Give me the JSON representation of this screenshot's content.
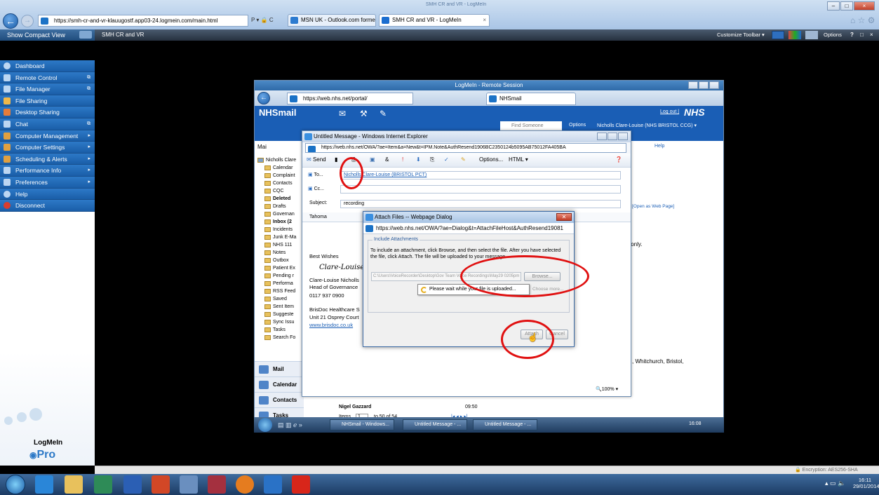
{
  "outer_browser": {
    "url": "https://smh-cr-and-vr-klauugostf.app03-24.logmein.com/main.html",
    "search_hint": "P ▾ 🔒 C",
    "tabs": [
      {
        "label": "MSN UK - Outlook.com forme..."
      },
      {
        "label": "SMH CR and VR - LogMeIn"
      }
    ],
    "tab_close": "×",
    "window_title": "SMH CR and VR - LogMeIn"
  },
  "logmein_toolbar": {
    "compact_view": "Show Compact View",
    "session_title": "SMH CR and VR",
    "customize_label": "Customize Toolbar ▾",
    "options_label": "Options",
    "help_label": "?",
    "win_min": "–",
    "win_close": "×"
  },
  "sidebar": {
    "items": [
      {
        "label": "Dashboard",
        "arrow": ""
      },
      {
        "label": "Remote Control",
        "arrow": "⧉"
      },
      {
        "label": "File Manager",
        "arrow": "⧉"
      },
      {
        "label": "File Sharing",
        "arrow": ""
      },
      {
        "label": "Desktop Sharing",
        "arrow": ""
      },
      {
        "label": "Chat",
        "arrow": "⧉"
      },
      {
        "label": "Computer Management",
        "arrow": "▸"
      },
      {
        "label": "Computer Settings",
        "arrow": "▸"
      },
      {
        "label": "Scheduling & Alerts",
        "arrow": "▸"
      },
      {
        "label": "Performance Info",
        "arrow": "▸"
      },
      {
        "label": "Preferences",
        "arrow": "▸"
      },
      {
        "label": "Help",
        "arrow": ""
      },
      {
        "label": "Disconnect",
        "arrow": ""
      }
    ],
    "logo_text": "LogMeIn",
    "logo_pro": "Pro"
  },
  "remote_window": {
    "title": "LogMeIn - Remote Session",
    "url": "https://web.nhs.net/portal/",
    "tab_label": "NHSmail",
    "nhsmail_brand": "NHSmail",
    "logout": "Log out |",
    "nhs_logo": "NHS",
    "find_someone": "Find Someone",
    "options": "Options",
    "user": "Nicholls Clare-Louise (NHS BRISTOL CCG) ▾",
    "help": "Help",
    "mail_label": "Mai",
    "open_web_page": "[Open as Web Page]",
    "only_text": "s only.",
    "whitchurch": ", Whitchurch, Bristol,",
    "folders": [
      "Nicholls Clare",
      "Calendar",
      "Complaint",
      "Contacts",
      "CQC",
      "Deleted",
      "Drafts",
      "Governan",
      "Inbox (2",
      "Incidents",
      "Junk E-Ma",
      "NHS 111",
      "Notes",
      "Outbox",
      "Patient Ex",
      "Pending r",
      "Performa",
      "RSS Feed",
      "Saved",
      "Sent Item",
      "Suggeste",
      "Sync Issu",
      "Tasks",
      "Search Fo"
    ],
    "nav_mail": "Mail",
    "nav_calendar": "Calendar",
    "nav_contacts": "Contacts",
    "nav_tasks": "Tasks",
    "list_sender": "Nigel Gazzard",
    "list_time": "09:50",
    "items_label": "Items",
    "items_value": "1",
    "items_range": "to 50 of 54",
    "pager": "|◂ ◂ ▸ ▸|"
  },
  "message_window": {
    "title": "Untitled Message - Windows Internet Explorer",
    "url": "https://web.nhs.net/OWA/?ae=Item&a=New&t=IPM.Note&AuthResend1906BC2350124b5095AB75012FA405BA",
    "send": "Send",
    "options": "Options...",
    "format": "HTML",
    "to_label": "To...",
    "to_value": "Nicholls Clare-Louise (BRISTOL PCT)",
    "cc_label": "Cc...",
    "subject_label": "Subject:",
    "subject_value": "recording",
    "font": "Tahoma",
    "body_best": "Best Wishes",
    "body_sig": "Clare-Louise",
    "body_name": "Clare-Louise Nicholls",
    "body_role": "Head of Governance",
    "body_phone": "0117 937 0900",
    "body_org": "BrisDoc Healthcare S",
    "body_addr": "Unit 21 Osprey Court",
    "body_web": "www.brisdoc.co.uk",
    "zoom": "100%"
  },
  "attach_dialog": {
    "title": "Attach Files -- Webpage Dialog",
    "url": "https://web.nhs.net/OWA/?ae=Dialog&t=AttachFileHost&AuthResend19081",
    "group_label": "Include Attachments",
    "instructions": "To include an attachment, click Browse, and then select the file. After you have selected the file, click Attach. The file will be uploaded to your message.",
    "file_path": "C:\\Users\\VoiceRecorder\\Desktop\\Gov Team Voice Recordings\\May29 0205pm",
    "browse": "Browse...",
    "choose_more": "Choose more...",
    "wait_msg": "Please wait while your file is uploaded...",
    "attach": "Attach",
    "cancel": "Cancel"
  },
  "remote_taskbar": {
    "tasks": [
      "NHSmail - Windows...",
      "Untitled Message - ...",
      "Untitled Message - ..."
    ],
    "time": "16:08"
  },
  "status_strip": {
    "encryption": "Encryption: AES256-SHA"
  },
  "taskbar": {
    "time": "16:11",
    "date": "29/01/2014"
  }
}
